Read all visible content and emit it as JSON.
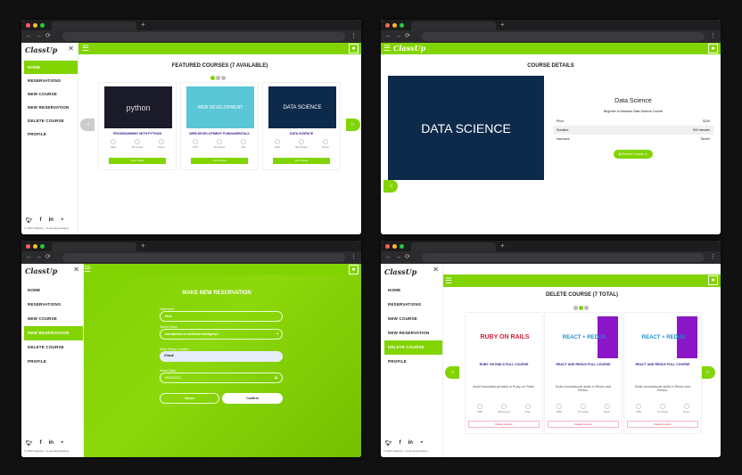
{
  "brand": {
    "logo": "ClassUp",
    "accent": "#82d400",
    "footer": "© 2023 ClassUp - eLearningAcademy"
  },
  "social": [
    "twitter-icon",
    "facebook-icon",
    "linkedin-icon",
    "github-icon"
  ],
  "menu": [
    "HOME",
    "RESERVATIONS",
    "NEW COURSE",
    "NEW RESERVATION",
    "DELETE COURSE",
    "PROFILE"
  ],
  "home": {
    "title": "FEATURED COURSES (7 AVAILABLE)",
    "cards": [
      {
        "title": "PROGRAMMING WITH PYTHON",
        "image": "python",
        "stats": [
          "$249",
          "60 minutes",
          "Tanner"
        ],
        "button": "View Detail"
      },
      {
        "title": "WEB DEVELOPMENT FUNDAMENTALS",
        "image": "WEB DEVELOPMENT",
        "stats": [
          "$179",
          "90 minutes",
          "Alex"
        ],
        "button": "View Detail"
      },
      {
        "title": "DATA SCIENCE",
        "image": "DATA SCIENCE",
        "stats": [
          "$149",
          "500 minutes",
          "Tanner"
        ],
        "button": "View Detail"
      }
    ]
  },
  "details": {
    "title": "COURSE DETAILS",
    "name": "Data Science",
    "subtitle": "Beginner to Advance Data Science Course",
    "image": "DATA SCIENCE",
    "rows": [
      {
        "label": "Price:",
        "value": "$149"
      },
      {
        "label": "Duration:",
        "value": "500 minutes"
      },
      {
        "label": "Instructor:",
        "value": "Tanner"
      }
    ],
    "reserve": "Reserve Course"
  },
  "reservation": {
    "title": "MAKE NEW RESERVATION",
    "username_label": "Username",
    "username": "Hein",
    "class_label": "Select Class",
    "class": "Introduction to Artificial Intelligence",
    "location_label": "Enter Study Location",
    "location": "Chauk",
    "date_label": "Select Date",
    "date": "06/06/2023",
    "cancel": "Cancel",
    "confirm": "Confirm"
  },
  "delete": {
    "title": "DELETE COURSE (7 TOTAL)",
    "cards": [
      {
        "title": "RUBY ON RAILS FULL COURSE",
        "image": "RUBY ON RAILS",
        "desc": "Build foundational skills in Ruby on Rails.",
        "stats": [
          "$199",
          "180 minutes",
          "Peter"
        ],
        "button": "Delete Course"
      },
      {
        "title": "REACT AND REDUX FULL COURSE",
        "image": "REACT + REDUX",
        "desc": "Build foundational skills in React and Redux.",
        "stats": [
          "$159",
          "75 minutes",
          "Emery"
        ],
        "button": "Delete Course"
      },
      {
        "title": "REACT AND REDUX FULL COURSE",
        "image": "REACT + REDUX",
        "desc": "Build foundational skills in React and Redux.",
        "stats": [
          "$159",
          "75 minutes",
          "Emery"
        ],
        "button": "Delete Course"
      }
    ]
  }
}
